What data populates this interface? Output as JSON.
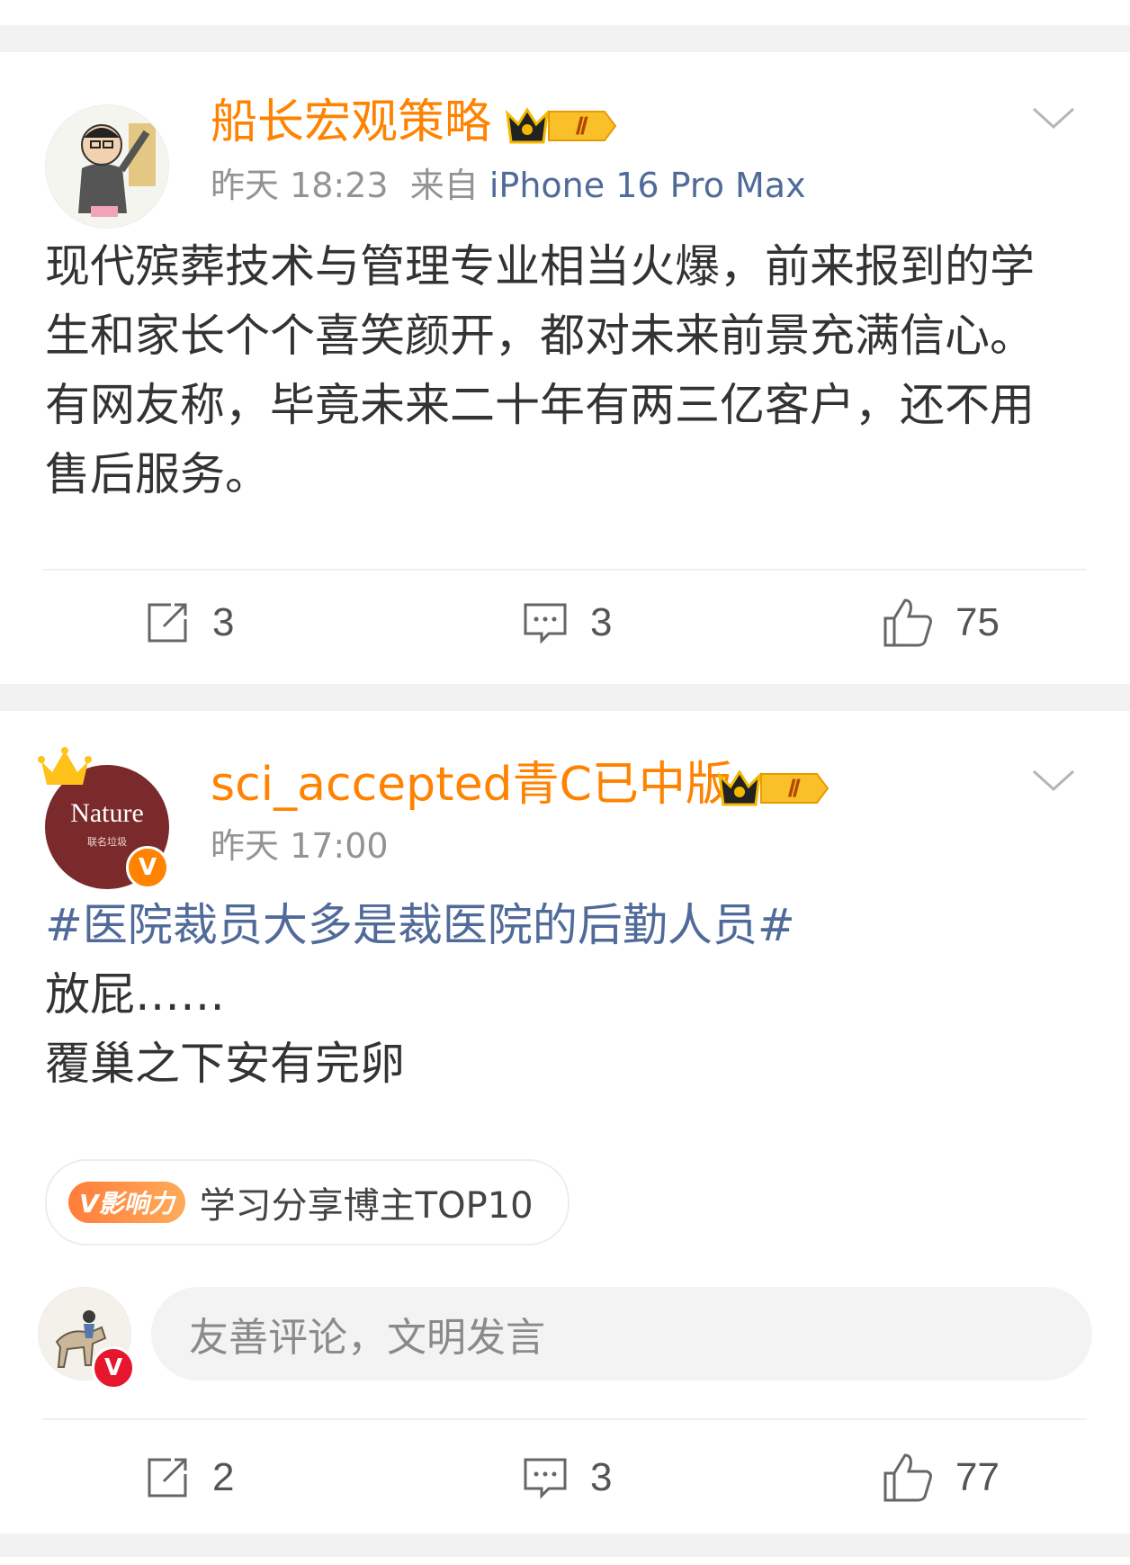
{
  "post1": {
    "username": "船长宏观策略",
    "time": "昨天 18:23",
    "source_prefix": "来自",
    "source": "iPhone 16 Pro Max",
    "content": "现代殡葬技术与管理专业相当火爆，前来报到的学生和家长个个喜笑颜开，都对未来前景充满信心。有网友称，毕竟未来二十年有两三亿客户，还不用售后服务。",
    "reposts": "3",
    "comments": "3",
    "likes": "75",
    "crown_level": "Ⅱ"
  },
  "post2": {
    "username": "sci_accepted青C已中版",
    "time": "昨天 17:00",
    "avatar_text": "Nature",
    "avatar_subtext": "联名垃圾",
    "hashtag": "#医院裁员大多是裁医院的后勤人员#",
    "line1": "放屁……",
    "line2": "覆巢之下安有完卵",
    "badge_label": "V影响力",
    "badge_text": "学习分享博主TOP10",
    "comment_placeholder": "友善评论，文明发言",
    "reposts": "2",
    "comments": "3",
    "likes": "77",
    "crown_level": "Ⅱ"
  },
  "colors": {
    "username": "#ff8200",
    "link": "#506b9a",
    "verified_orange": "#ff8200",
    "verified_red": "#e6162d"
  }
}
